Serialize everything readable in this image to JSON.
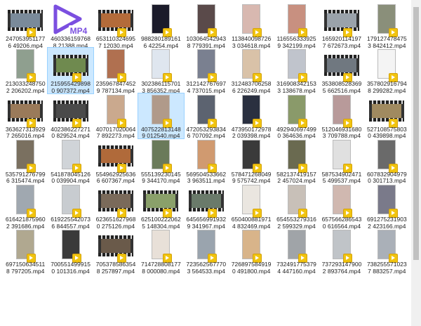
{
  "files": [
    {
      "name": "2470539511776 49206.mp4",
      "kind": "film",
      "color": "#7a8a9a"
    },
    {
      "name": "4603361597688 21388.mp4",
      "kind": "mp4-icon",
      "color": "#6a3fd6"
    },
    {
      "name": "6531103246957 12030.mp4",
      "kind": "film",
      "color": "#b36b3a"
    },
    {
      "name": "9882801891616 42254.mp4",
      "kind": "portrait",
      "color": "#1b1b2a"
    },
    {
      "name": "1030645429438 779391.mp4",
      "kind": "portrait",
      "color": "#5a4a4a"
    },
    {
      "name": "1138400987263 034618.mp4",
      "kind": "portrait",
      "color": "#d8b8b0"
    },
    {
      "name": "1165563339259 342199.mp4",
      "kind": "portrait",
      "color": "#c89080"
    },
    {
      "name": "1659201141977 672673.mp4",
      "kind": "film",
      "color": "#9aa2aa"
    },
    {
      "name": "1791274784753 842412.mp4",
      "kind": "portrait",
      "color": "#8a8f7a"
    },
    {
      "name": "2130332487502 206202.mp4",
      "kind": "portrait",
      "color": "#8f9f8f"
    },
    {
      "name": "2159554298980 907372.mp4",
      "kind": "film",
      "color": "#6f8a4f",
      "selected": true
    },
    {
      "name": "2359678474529 787134.mp4",
      "kind": "portrait",
      "color": "#b07050"
    },
    {
      "name": "3023861157013 856352.mp4",
      "kind": "portrait",
      "color": "#dfe6ef"
    },
    {
      "name": "3121427676974 737015.mp4",
      "kind": "portrait",
      "color": "#7a8090"
    },
    {
      "name": "3124837062586 226249.mp4",
      "kind": "portrait",
      "color": "#d9c2a8"
    },
    {
      "name": "3169083421533 138678.mp4",
      "kind": "portrait",
      "color": "#c0c4cc"
    },
    {
      "name": "3538085283695 662516.mp4",
      "kind": "film",
      "color": "#707880"
    },
    {
      "name": "3578029167948 299282.mp4",
      "kind": "portrait",
      "color": "#f4f4f4"
    },
    {
      "name": "3636273139297 265016.mp4",
      "kind": "film",
      "color": "#9a7a5a"
    },
    {
      "name": "4023862272710 829524.mp4",
      "kind": "film",
      "color": "#4a4a4a"
    },
    {
      "name": "4070170200647 892273.mp4",
      "kind": "portrait",
      "color": "#caa98e"
    },
    {
      "name": "4075228131489 012540.mp4",
      "kind": "portrait",
      "color": "#b09a8a",
      "selected": true
    },
    {
      "name": "4720532938346 707092.mp4",
      "kind": "portrait",
      "color": "#5c6370"
    },
    {
      "name": "4739501729782 039398.mp4",
      "kind": "portrait",
      "color": "#2a3040"
    },
    {
      "name": "4929406974990 364636.mp4",
      "kind": "portrait",
      "color": "#8a9a6a"
    },
    {
      "name": "5120469316803 709788.mp4",
      "kind": "portrait",
      "color": "#b89a9a"
    },
    {
      "name": "5271085758030 439898.mp4",
      "kind": "film",
      "color": "#a08a60"
    },
    {
      "name": "5357912767996 315474.mp4",
      "kind": "portrait",
      "color": "#7a7060"
    },
    {
      "name": "5418780451260 039904.mp4",
      "kind": "portrait",
      "color": "#d0d4d8"
    },
    {
      "name": "5549629256366 607367.mp4",
      "kind": "film",
      "color": "#b06a3a"
    },
    {
      "name": "5551392301459 344170.mp4",
      "kind": "portrait",
      "color": "#6a7a5a"
    },
    {
      "name": "5695045336623 963511.mp4",
      "kind": "portrait",
      "color": "#d09a70"
    },
    {
      "name": "5784712680499 575742.mp4",
      "kind": "portrait",
      "color": "#3a3a3a"
    },
    {
      "name": "5821374191572 457024.mp4",
      "kind": "portrait",
      "color": "#6a6a50"
    },
    {
      "name": "5875349024715 499537.mp4",
      "kind": "portrait",
      "color": "#e0e0e0"
    },
    {
      "name": "6078329049790 301713.mp4",
      "kind": "portrait",
      "color": "#6a6a6a"
    },
    {
      "name": "6164218759602 391686.mp4",
      "kind": "portrait",
      "color": "#a0a8b0"
    },
    {
      "name": "6192255420736 844557.mp4",
      "kind": "portrait",
      "color": "#c8ccd0"
    },
    {
      "name": "6236516279680 275126.mp4",
      "kind": "film",
      "color": "#7a6a5a"
    },
    {
      "name": "6251002220625 148304.mp4",
      "kind": "film",
      "color": "#8aa06a"
    },
    {
      "name": "6456569919329 341967.mp4",
      "kind": "film",
      "color": "#6a7a6a"
    },
    {
      "name": "6504008819714 832469.mp4",
      "kind": "portrait",
      "color": "#eae6e0"
    },
    {
      "name": "6545532793162 599329.mp4",
      "kind": "portrait",
      "color": "#c8c0b8"
    },
    {
      "name": "6575662865430 616564.mp4",
      "kind": "portrait",
      "color": "#d0b8b0"
    },
    {
      "name": "6912752319032 423166.mp4",
      "kind": "portrait",
      "color": "#7a7a8a"
    },
    {
      "name": "6971506345118 797205.mp4",
      "kind": "portrait",
      "color": "#b0a890"
    },
    {
      "name": "7005514999150 101316.mp4",
      "kind": "portrait",
      "color": "#3a3a3a"
    },
    {
      "name": "7053785863548 257897.mp4",
      "kind": "film",
      "color": "#6a5a4a"
    },
    {
      "name": "7147288081778 000080.mp4",
      "kind": "portrait",
      "color": "#e8e0d8"
    },
    {
      "name": "7235625677703 564533.mp4",
      "kind": "portrait",
      "color": "#9aa4ae"
    },
    {
      "name": "7268975849190 491800.mp4",
      "kind": "portrait",
      "color": "#d8b48a"
    },
    {
      "name": "7324917753794 447160.mp4",
      "kind": "portrait",
      "color": "#a0a4a8"
    },
    {
      "name": "7372931479002 893764.mp4",
      "kind": "portrait",
      "color": "#c0c4c8"
    },
    {
      "name": "7382555710237 883257.mp4",
      "kind": "portrait",
      "color": "#aab0b8"
    }
  ]
}
